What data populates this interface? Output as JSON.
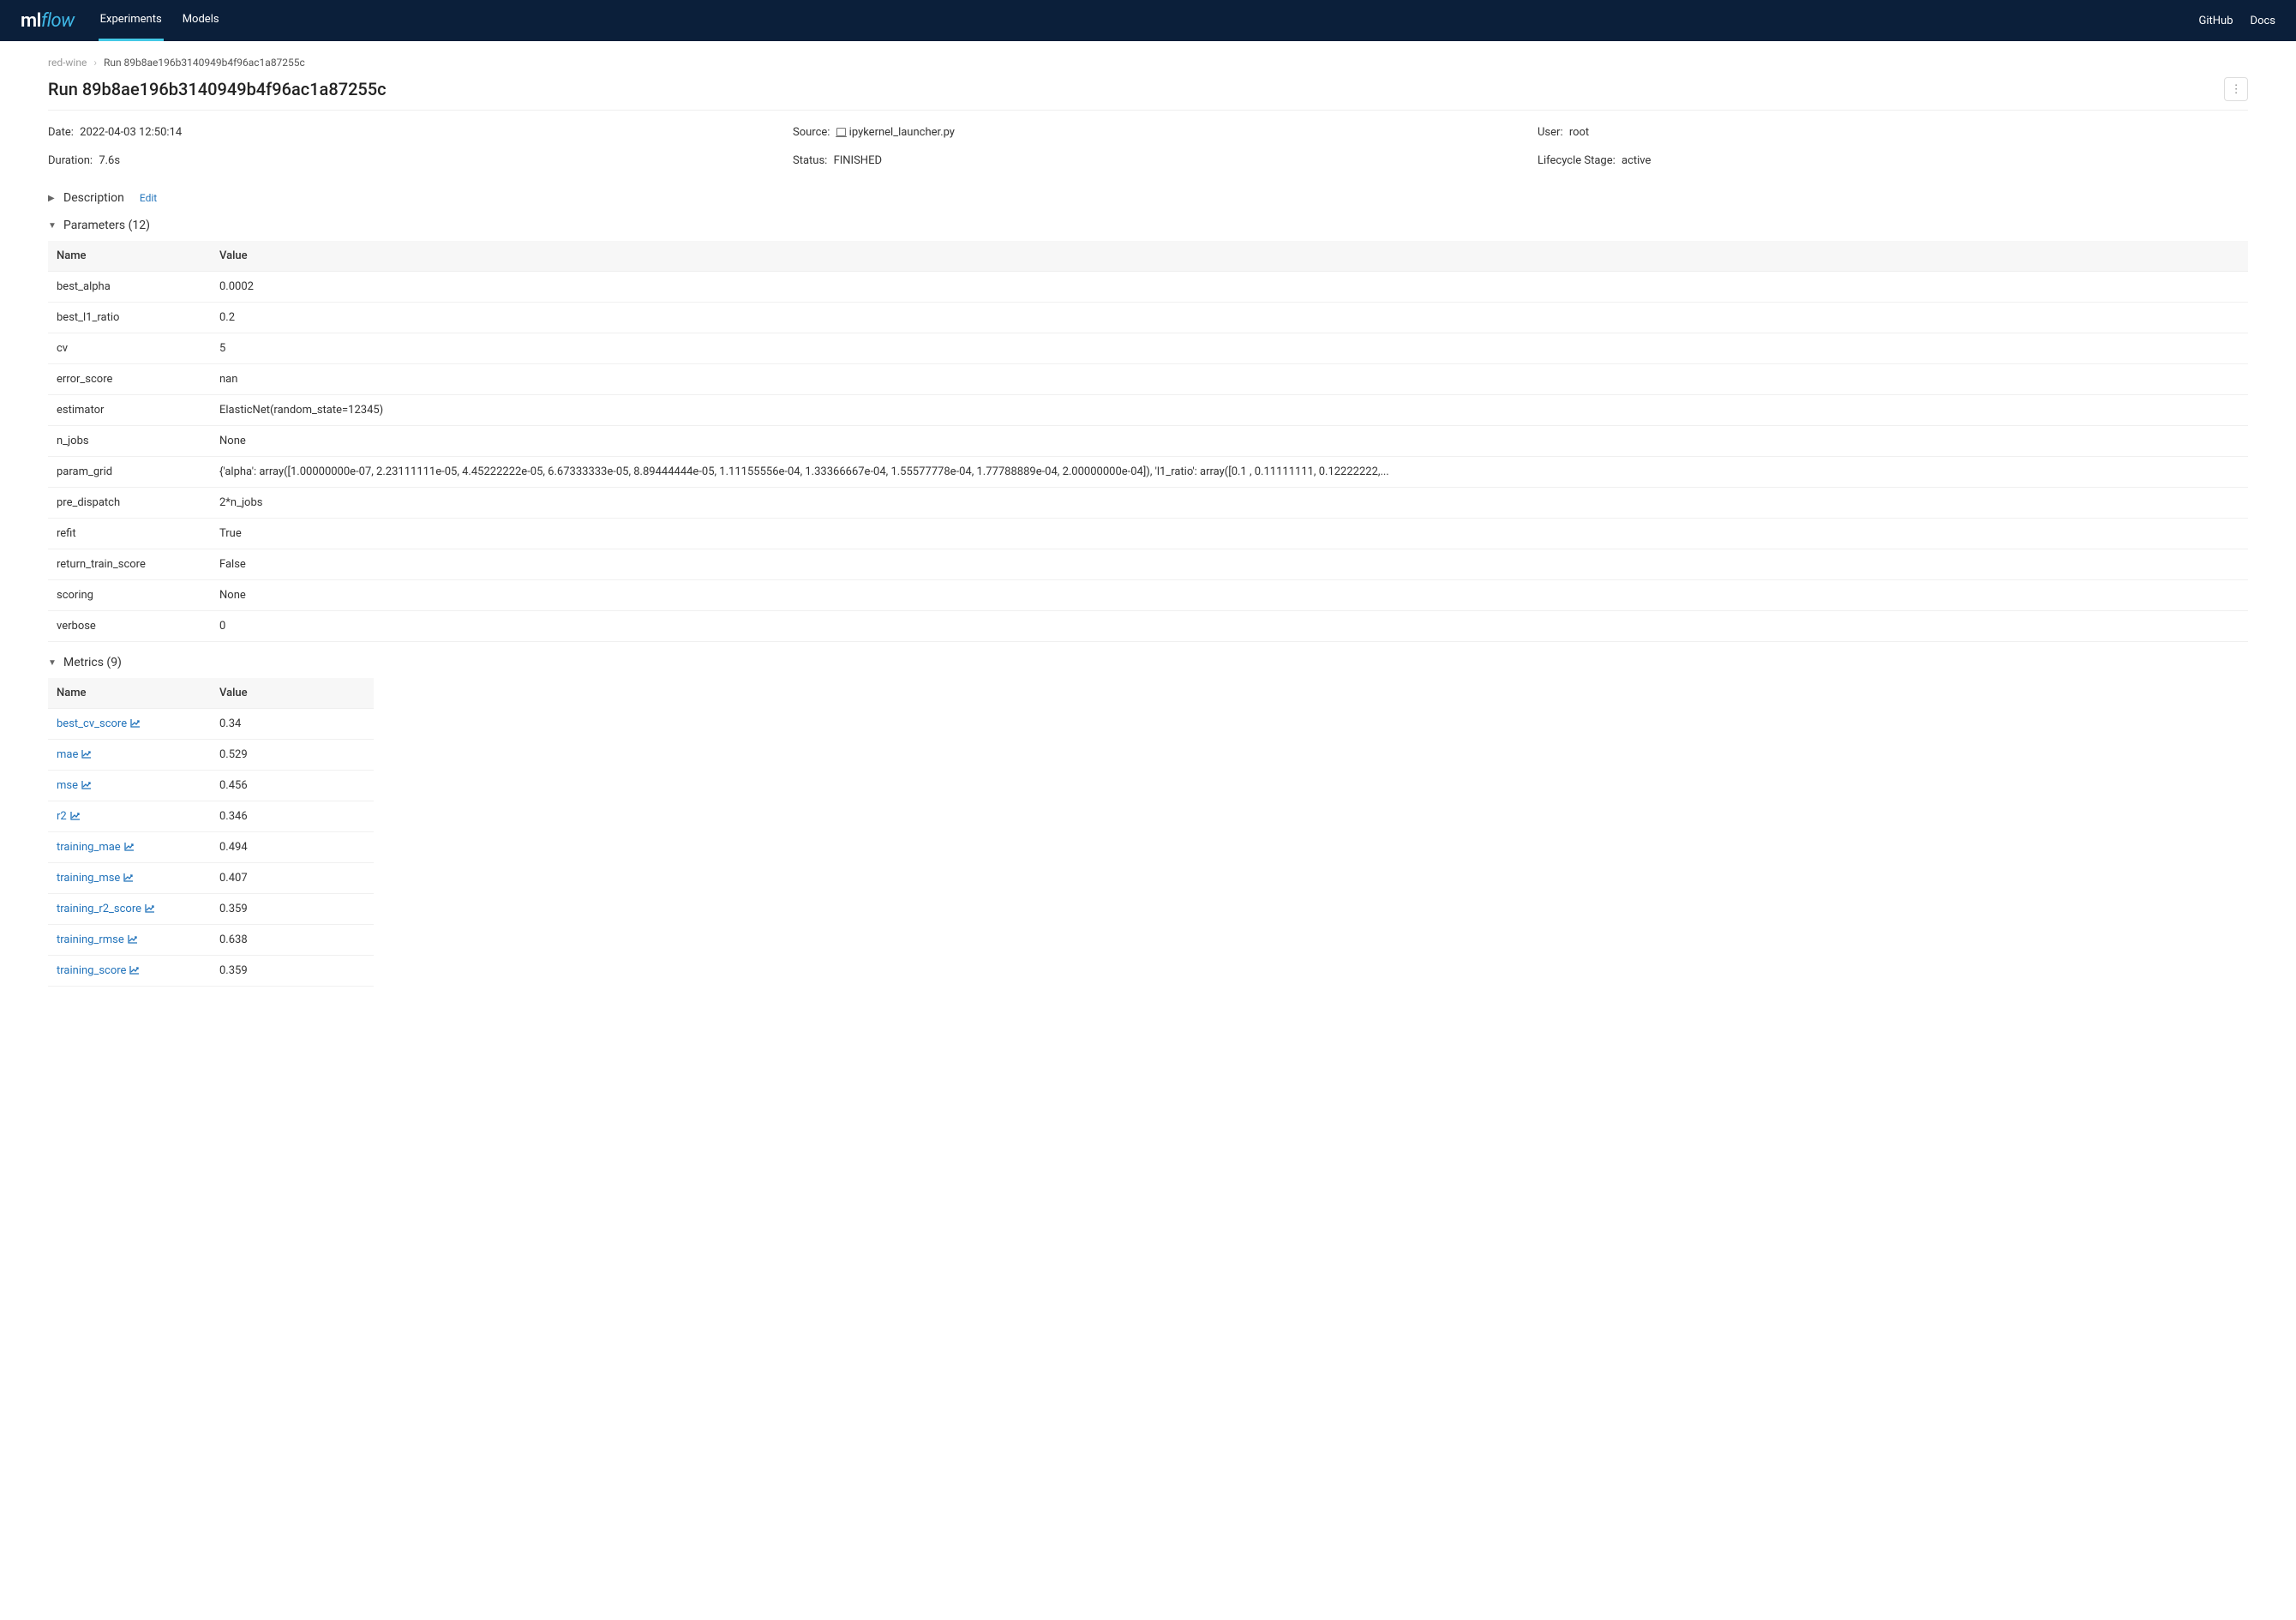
{
  "navbar": {
    "logo_ml": "ml",
    "logo_flow": "flow",
    "tabs": {
      "experiments": "Experiments",
      "models": "Models"
    },
    "links": {
      "github": "GitHub",
      "docs": "Docs"
    }
  },
  "breadcrumb": {
    "parent": "red-wine",
    "current": "Run 89b8ae196b3140949b4f96ac1a87255c"
  },
  "title": "Run 89b8ae196b3140949b4f96ac1a87255c",
  "meta": {
    "date": {
      "label": "Date:",
      "value": "2022-04-03 12:50:14"
    },
    "source": {
      "label": "Source:",
      "value": "ipykernel_launcher.py"
    },
    "user": {
      "label": "User:",
      "value": "root"
    },
    "duration": {
      "label": "Duration:",
      "value": "7.6s"
    },
    "status": {
      "label": "Status:",
      "value": "FINISHED"
    },
    "lifecycle": {
      "label": "Lifecycle Stage:",
      "value": "active"
    }
  },
  "sections": {
    "description": {
      "title": "Description",
      "edit": "Edit"
    },
    "parameters": {
      "title": "Parameters (12)"
    },
    "metrics": {
      "title": "Metrics (9)"
    }
  },
  "table_headers": {
    "name": "Name",
    "value": "Value"
  },
  "parameters": [
    {
      "name": "best_alpha",
      "value": "0.0002"
    },
    {
      "name": "best_l1_ratio",
      "value": "0.2"
    },
    {
      "name": "cv",
      "value": "5"
    },
    {
      "name": "error_score",
      "value": "nan"
    },
    {
      "name": "estimator",
      "value": "ElasticNet(random_state=12345)"
    },
    {
      "name": "n_jobs",
      "value": "None"
    },
    {
      "name": "param_grid",
      "value": "{'alpha': array([1.00000000e-07, 2.23111111e-05, 4.45222222e-05, 6.67333333e-05, 8.89444444e-05, 1.11155556e-04, 1.33366667e-04, 1.55577778e-04, 1.77788889e-04, 2.00000000e-04]), 'l1_ratio': array([0.1 , 0.11111111, 0.12222222,..."
    },
    {
      "name": "pre_dispatch",
      "value": "2*n_jobs"
    },
    {
      "name": "refit",
      "value": "True"
    },
    {
      "name": "return_train_score",
      "value": "False"
    },
    {
      "name": "scoring",
      "value": "None"
    },
    {
      "name": "verbose",
      "value": "0"
    }
  ],
  "metrics": [
    {
      "name": "best_cv_score",
      "value": "0.34"
    },
    {
      "name": "mae",
      "value": "0.529"
    },
    {
      "name": "mse",
      "value": "0.456"
    },
    {
      "name": "r2",
      "value": "0.346"
    },
    {
      "name": "training_mae",
      "value": "0.494"
    },
    {
      "name": "training_mse",
      "value": "0.407"
    },
    {
      "name": "training_r2_score",
      "value": "0.359"
    },
    {
      "name": "training_rmse",
      "value": "0.638"
    },
    {
      "name": "training_score",
      "value": "0.359"
    }
  ]
}
